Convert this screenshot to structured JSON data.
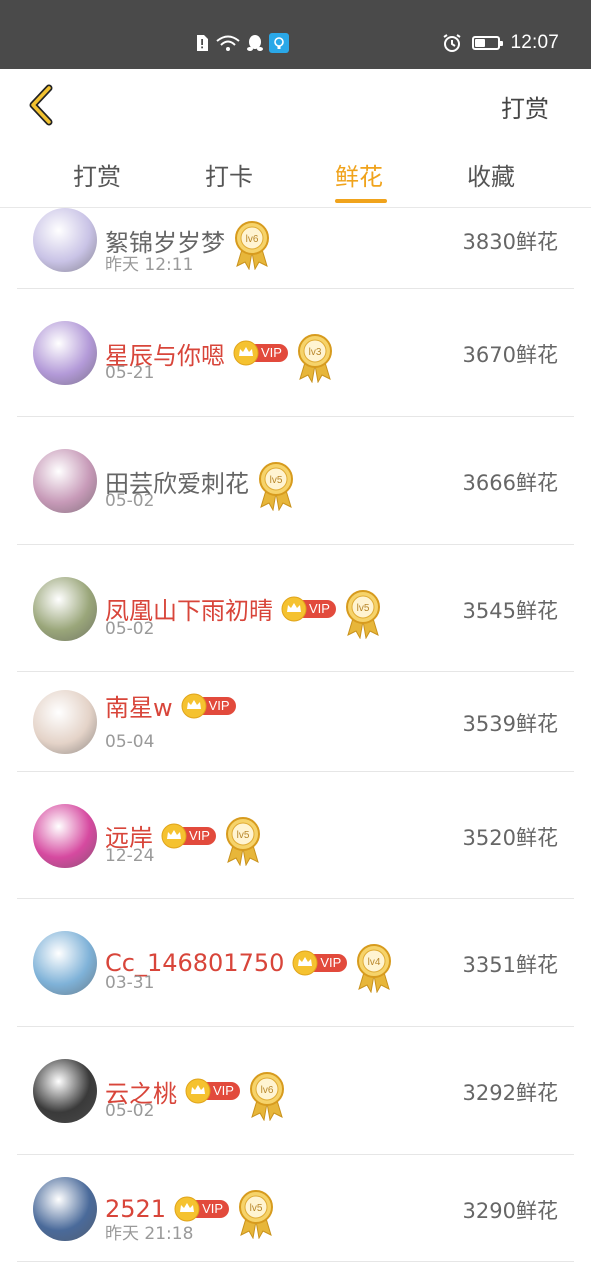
{
  "status_bar": {
    "time": "12:07"
  },
  "header": {
    "action_label": "打赏"
  },
  "tabs": [
    {
      "label": "打赏",
      "active": false
    },
    {
      "label": "打卡",
      "active": false
    },
    {
      "label": "鲜花",
      "active": true
    },
    {
      "label": "收藏",
      "active": false
    }
  ],
  "list": [
    {
      "name": "絮锦岁岁梦",
      "vip": false,
      "level": "lv6",
      "date": "昨天 12:11",
      "amount": "3830鲜花",
      "avatar_color": "#c9c3e6"
    },
    {
      "name": "星辰与你嗯",
      "vip": true,
      "vip_label": "VIP",
      "level": "lv3",
      "date": "05-21",
      "amount": "3670鲜花",
      "avatar_color": "#b39ad8"
    },
    {
      "name": "田芸欣爱刺花",
      "vip": false,
      "level": "lv5",
      "date": "05-02",
      "amount": "3666鲜花",
      "avatar_color": "#c79ab8"
    },
    {
      "name": "凤凰山下雨初晴",
      "vip": true,
      "vip_label": "VIP",
      "level": "lv5",
      "date": "05-02",
      "amount": "3545鲜花",
      "avatar_color": "#9aa67a"
    },
    {
      "name": "南星w",
      "vip": true,
      "vip_label": "VIP",
      "level": "",
      "date": "05-04",
      "amount": "3539鲜花",
      "avatar_color": "#e4d3c8"
    },
    {
      "name": "远岸",
      "vip": true,
      "vip_label": "VIP",
      "level": "lv5",
      "date": "12-24",
      "amount": "3520鲜花",
      "avatar_color": "#d64aa0"
    },
    {
      "name": "Cc_146801750",
      "vip": true,
      "vip_label": "VIP",
      "level": "lv4",
      "date": "03-31",
      "amount": "3351鲜花",
      "avatar_color": "#7fb2d8"
    },
    {
      "name": "云之桃",
      "vip": true,
      "vip_label": "VIP",
      "level": "lv6",
      "date": "05-02",
      "amount": "3292鲜花",
      "avatar_color": "#3a3a3a"
    },
    {
      "name": "2521",
      "vip": true,
      "vip_label": "VIP",
      "level": "lv5",
      "date": "昨天 21:18",
      "amount": "3290鲜花",
      "avatar_color": "#4a6a9a"
    }
  ],
  "colors": {
    "accent": "#f0a31c",
    "vip_name": "#d8453a",
    "vip_pill": "#e24a3c"
  }
}
